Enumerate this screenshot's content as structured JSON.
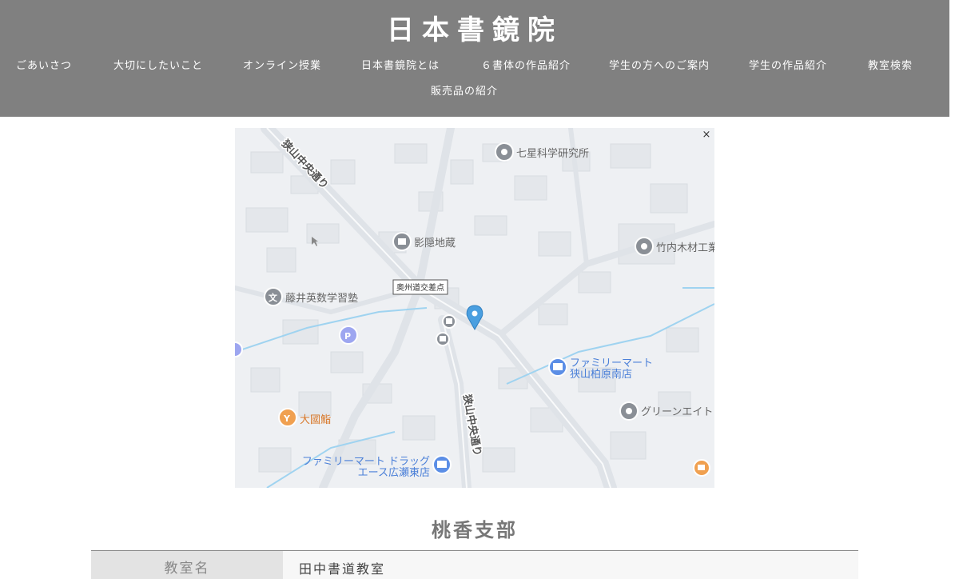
{
  "site": {
    "logo_text": "日本書鏡院"
  },
  "nav": {
    "items": [
      {
        "label": "ごあいさつ"
      },
      {
        "label": "大切にしたいこと"
      },
      {
        "label": "オンライン授業"
      },
      {
        "label": "日本書鏡院とは"
      },
      {
        "label": "６書体の作品紹介"
      },
      {
        "label": "学生の方へのご案内"
      },
      {
        "label": "学生の作品紹介"
      },
      {
        "label": "教室検索"
      },
      {
        "label": "販売品の紹介"
      }
    ]
  },
  "map": {
    "close_label": "×",
    "labels": {
      "road_top": "狭山中央通り",
      "road_bottom": "狭山中央通り",
      "shichisei": "七星科学研究所",
      "kageon": "影隠地蔵",
      "takeuchi": "竹内木材工業",
      "fujii": "藤井英数学習塾",
      "intersection": "奥州道交差点",
      "famima_line1": "ファミリーマート",
      "famima_line2": "狭山柏原南店",
      "green": "グリーンエイト",
      "daikoku": "大國鮨",
      "famima2_line1": "ファミリーマート ドラッグ",
      "famima2_line2": "エース広瀬東店"
    },
    "colors": {
      "pin": "#4a9fe0",
      "poi_gray": "#8a8f96",
      "poi_blue": "#5b8ee6",
      "poi_orange": "#f0a050",
      "road": "#dde1e6",
      "water": "#9fd3f0"
    }
  },
  "branch": {
    "title": "桃香支部",
    "rows": [
      {
        "label": "教室名",
        "value": "田中書道教室"
      }
    ]
  }
}
